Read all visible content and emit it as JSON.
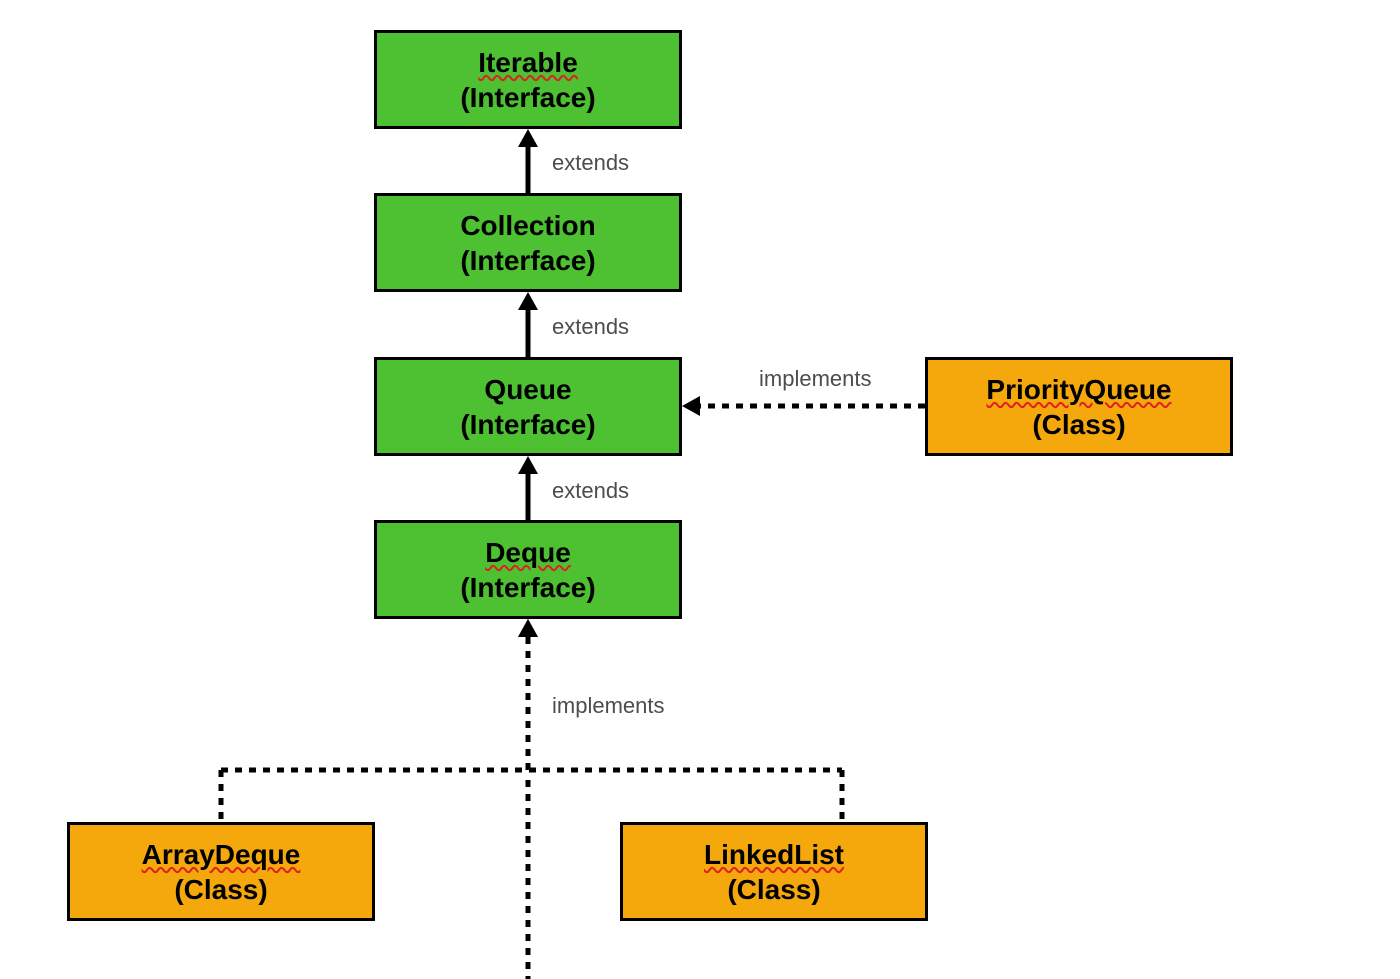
{
  "colors": {
    "interface_bg": "#4dc132",
    "class_bg": "#f5a80b",
    "stroke": "#000000",
    "label_text": "#4d4d4d",
    "spell_wave": "#e02020"
  },
  "nodes": {
    "iterable": {
      "name": "Iterable",
      "kind": "(Interface)",
      "type": "interface",
      "spellwave": true
    },
    "collection": {
      "name": "Collection",
      "kind": "(Interface)",
      "type": "interface",
      "spellwave": false
    },
    "queue": {
      "name": "Queue",
      "kind": "(Interface)",
      "type": "interface",
      "spellwave": false
    },
    "deque": {
      "name": "Deque",
      "kind": "(Interface)",
      "type": "interface",
      "spellwave": true
    },
    "priorityqueue": {
      "name": "PriorityQueue",
      "kind": "(Class)",
      "type": "class",
      "spellwave": true
    },
    "arraydeque": {
      "name": "ArrayDeque",
      "kind": "(Class)",
      "type": "class",
      "spellwave": true
    },
    "linkedlist": {
      "name": "LinkedList",
      "kind": "(Class)",
      "type": "class",
      "spellwave": true
    }
  },
  "labels": {
    "extends1": "extends",
    "extends2": "extends",
    "extends3": "extends",
    "implements1": "implements",
    "implements2": "implements"
  },
  "edges": [
    {
      "from": "collection",
      "to": "iterable",
      "style": "solid",
      "label_key": "extends1"
    },
    {
      "from": "queue",
      "to": "collection",
      "style": "solid",
      "label_key": "extends2"
    },
    {
      "from": "deque",
      "to": "queue",
      "style": "solid",
      "label_key": "extends3"
    },
    {
      "from": "priorityqueue",
      "to": "queue",
      "style": "dashed",
      "label_key": "implements1"
    },
    {
      "from": [
        "arraydeque",
        "linkedlist"
      ],
      "to": "deque",
      "style": "dashed",
      "label_key": "implements2"
    }
  ]
}
